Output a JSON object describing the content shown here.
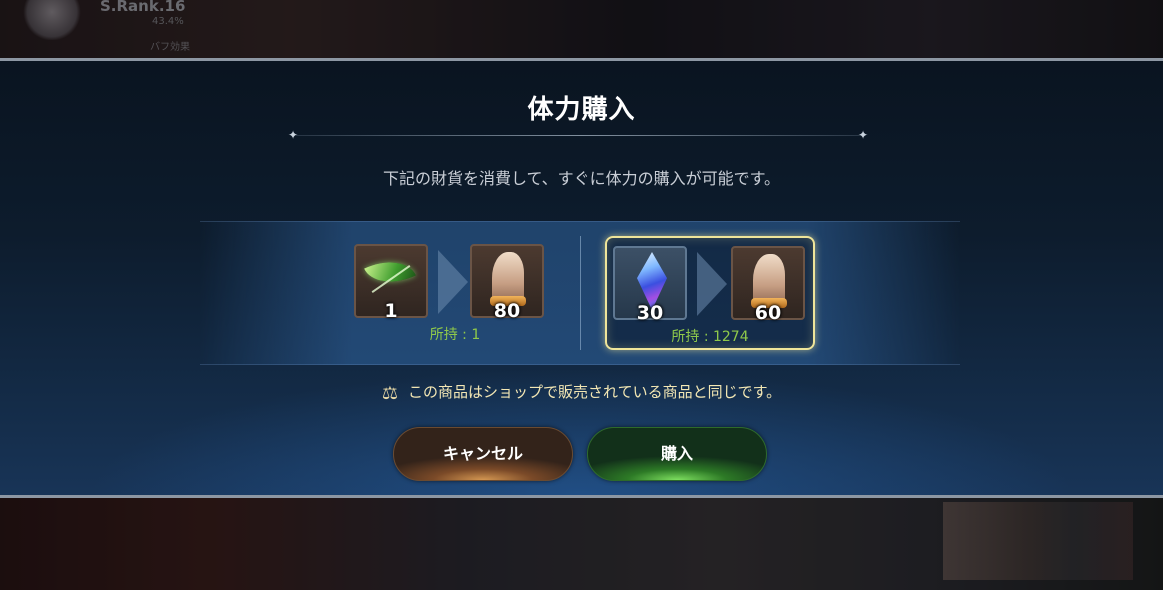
{
  "background": {
    "rank_label": "S.Rank.16",
    "progress_text": "43.4%",
    "buff_label": "バフ効果"
  },
  "dialog": {
    "title": "体力購入",
    "description": "下記の財貨を消費して、すぐに体力の購入が可能です。",
    "notice": "この商品はショップで販売されている商品と同じです。",
    "options": [
      {
        "cost_icon": "leaf-icon",
        "cost_qty": "1",
        "reward_icon": "knight-stamina-icon",
        "reward_qty": "80",
        "owned": "所持 : 1",
        "selected": false
      },
      {
        "cost_icon": "crystal-gem-icon",
        "cost_qty": "30",
        "reward_icon": "knight-stamina-icon",
        "reward_qty": "60",
        "owned": "所持 : 1274",
        "selected": true
      }
    ],
    "buttons": {
      "cancel_label": "キャンセル",
      "buy_label": "購入"
    }
  },
  "colors": {
    "owned_text": "#8fc94a",
    "selected_border": "#efe59a",
    "notice_text": "#f3e7b4"
  }
}
